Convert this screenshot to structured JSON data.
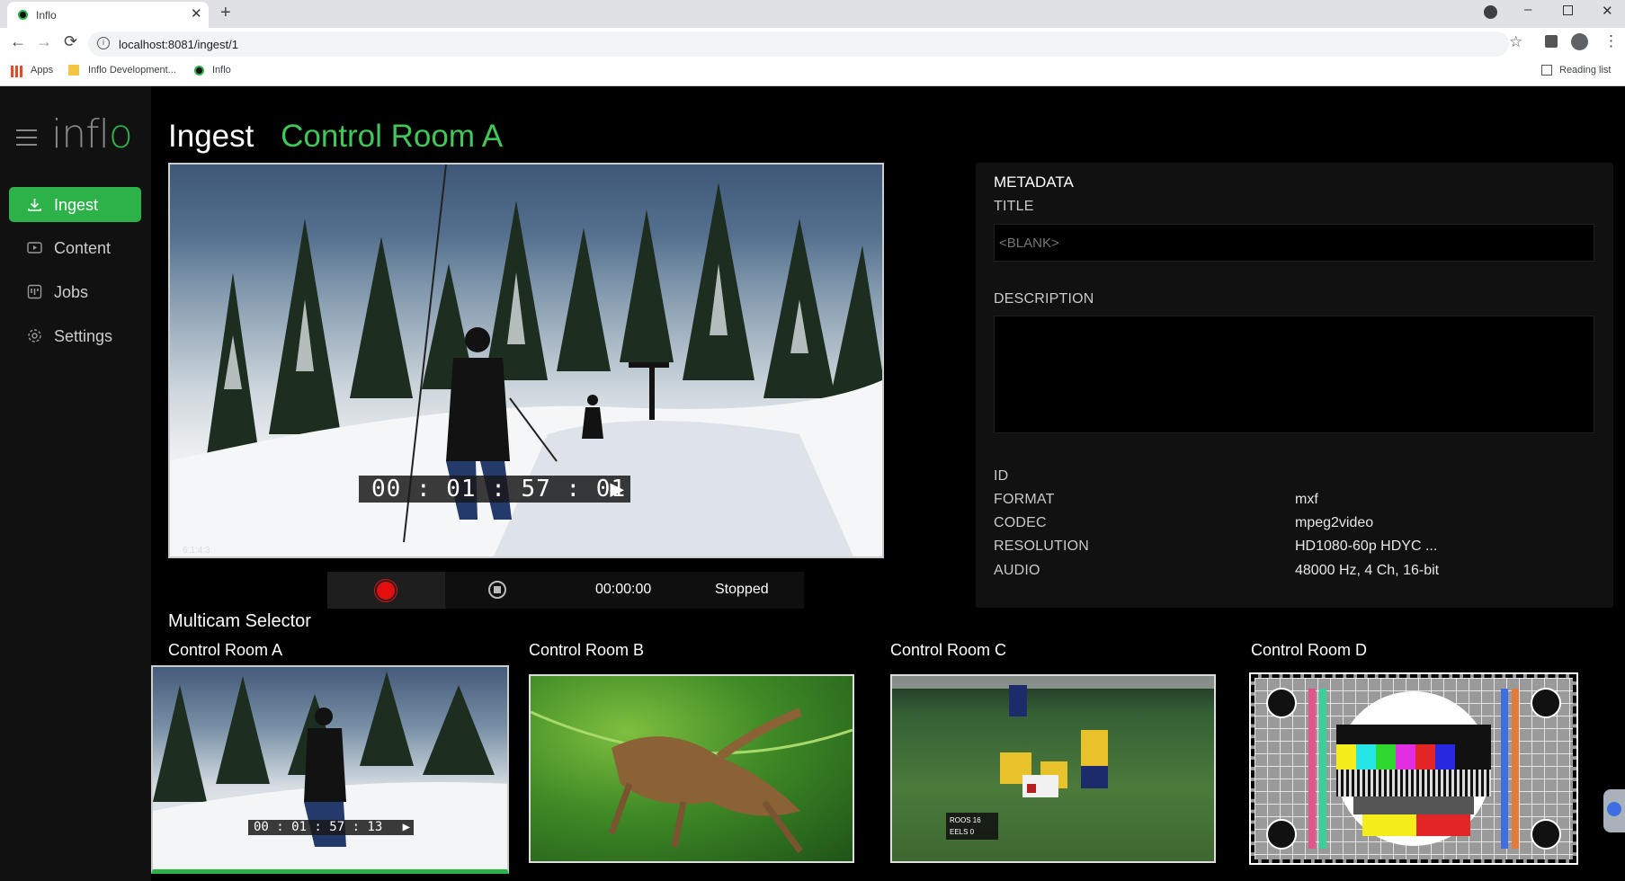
{
  "browser": {
    "tab_title": "Inflo",
    "url": "localhost:8081/ingest/1",
    "bookmarks": [
      "Apps",
      "Inflo Development...",
      "Inflo"
    ],
    "reading_list": "Reading list"
  },
  "app": {
    "logo": "inflo",
    "nav": [
      {
        "label": "Ingest",
        "icon": "download-icon",
        "active": true
      },
      {
        "label": "Content",
        "icon": "play-box-icon",
        "active": false
      },
      {
        "label": "Jobs",
        "icon": "kanban-icon",
        "active": false
      },
      {
        "label": "Settings",
        "icon": "gear-icon",
        "active": false
      }
    ]
  },
  "page": {
    "title": "Ingest",
    "subtitle": "Control Room A"
  },
  "player": {
    "timecode": "00 : 01 : 57 : 01",
    "safe_label": "6:1:4:3"
  },
  "recorder": {
    "elapsed": "00:00:00",
    "status": "Stopped"
  },
  "metadata": {
    "heading": "METADATA",
    "title_label": "TITLE",
    "title_placeholder": "<BLANK>",
    "description_label": "DESCRIPTION",
    "fields": [
      {
        "label": "ID",
        "value": ""
      },
      {
        "label": "FORMAT",
        "value": "mxf"
      },
      {
        "label": "CODEC",
        "value": "mpeg2video"
      },
      {
        "label": "RESOLUTION",
        "value": "HD1080-60p HDYC ..."
      },
      {
        "label": "AUDIO",
        "value": "48000 Hz, 4 Ch, 16-bit"
      }
    ]
  },
  "multicam": {
    "heading": "Multicam Selector",
    "cams": [
      {
        "label": "Control Room A",
        "timecode": "00 : 01 : 57 : 13",
        "selected": true
      },
      {
        "label": "Control Room B",
        "selected": false
      },
      {
        "label": "Control Room C",
        "selected": false,
        "score": [
          "ROOS 16",
          "EELS 0"
        ]
      },
      {
        "label": "Control Room D",
        "selected": false
      }
    ]
  },
  "colors": {
    "accent": "#2db24a",
    "accent_text": "#3fc758",
    "background": "#000000",
    "sidebar": "#111111",
    "record": "#e30f0f"
  }
}
